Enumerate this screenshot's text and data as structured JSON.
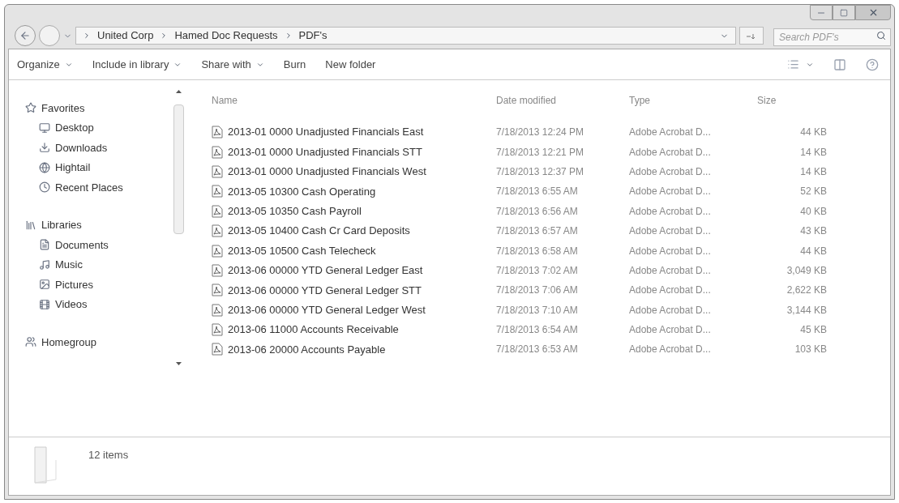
{
  "address_bar": {
    "crumbs": [
      "United Corp",
      "Hamed Doc Requests",
      "PDF's"
    ]
  },
  "search": {
    "placeholder": "Search PDF's"
  },
  "toolbar": {
    "items": [
      {
        "label": "Organize",
        "dropdown": true
      },
      {
        "label": "Include in library",
        "dropdown": true
      },
      {
        "label": "Share with",
        "dropdown": true
      },
      {
        "label": "Burn",
        "dropdown": false
      },
      {
        "label": "New folder",
        "dropdown": false
      }
    ]
  },
  "sidebar": {
    "groups": [
      {
        "label": "Favorites",
        "children": [
          {
            "label": "Desktop"
          },
          {
            "label": "Downloads"
          },
          {
            "label": "Hightail"
          },
          {
            "label": "Recent Places"
          }
        ]
      },
      {
        "label": "Libraries",
        "children": [
          {
            "label": "Documents"
          },
          {
            "label": "Music"
          },
          {
            "label": "Pictures"
          },
          {
            "label": "Videos"
          }
        ]
      },
      {
        "label": "Homegroup"
      }
    ]
  },
  "table": {
    "columns": [
      "Name",
      "Date modified",
      "Type",
      "Size"
    ],
    "rows": [
      {
        "name": "2013-01 0000 Unadjusted Financials East",
        "date": "7/18/2013 12:24 PM",
        "type": "Adobe Acrobat D...",
        "size": "44 KB"
      },
      {
        "name": "2013-01 0000 Unadjusted Financials STT",
        "date": "7/18/2013 12:21 PM",
        "type": "Adobe Acrobat D...",
        "size": "14 KB"
      },
      {
        "name": "2013-01 0000 Unadjusted Financials West",
        "date": "7/18/2013 12:37 PM",
        "type": "Adobe Acrobat D...",
        "size": "14 KB"
      },
      {
        "name": "2013-05 10300 Cash Operating",
        "date": "7/18/2013 6:55 AM",
        "type": "Adobe Acrobat D...",
        "size": "52 KB"
      },
      {
        "name": "2013-05 10350 Cash Payroll",
        "date": "7/18/2013 6:56 AM",
        "type": "Adobe Acrobat D...",
        "size": "40 KB"
      },
      {
        "name": "2013-05 10400 Cash Cr Card Deposits",
        "date": "7/18/2013 6:57 AM",
        "type": "Adobe Acrobat D...",
        "size": "43 KB"
      },
      {
        "name": "2013-05 10500 Cash Telecheck",
        "date": "7/18/2013 6:58 AM",
        "type": "Adobe Acrobat D...",
        "size": "44 KB"
      },
      {
        "name": "2013-06 00000 YTD General Ledger East",
        "date": "7/18/2013 7:02 AM",
        "type": "Adobe Acrobat D...",
        "size": "3,049 KB"
      },
      {
        "name": "2013-06 00000 YTD General Ledger STT",
        "date": "7/18/2013 7:06 AM",
        "type": "Adobe Acrobat D...",
        "size": "2,622 KB"
      },
      {
        "name": "2013-06 00000 YTD General Ledger West",
        "date": "7/18/2013 7:10 AM",
        "type": "Adobe Acrobat D...",
        "size": "3,144 KB"
      },
      {
        "name": "2013-06 11000 Accounts Receivable",
        "date": "7/18/2013 6:54 AM",
        "type": "Adobe Acrobat D...",
        "size": "45 KB"
      },
      {
        "name": "2013-06 20000 Accounts Payable",
        "date": "7/18/2013 6:53 AM",
        "type": "Adobe Acrobat D...",
        "size": "103 KB"
      }
    ]
  },
  "details_pane": {
    "item_count": "12 items"
  }
}
